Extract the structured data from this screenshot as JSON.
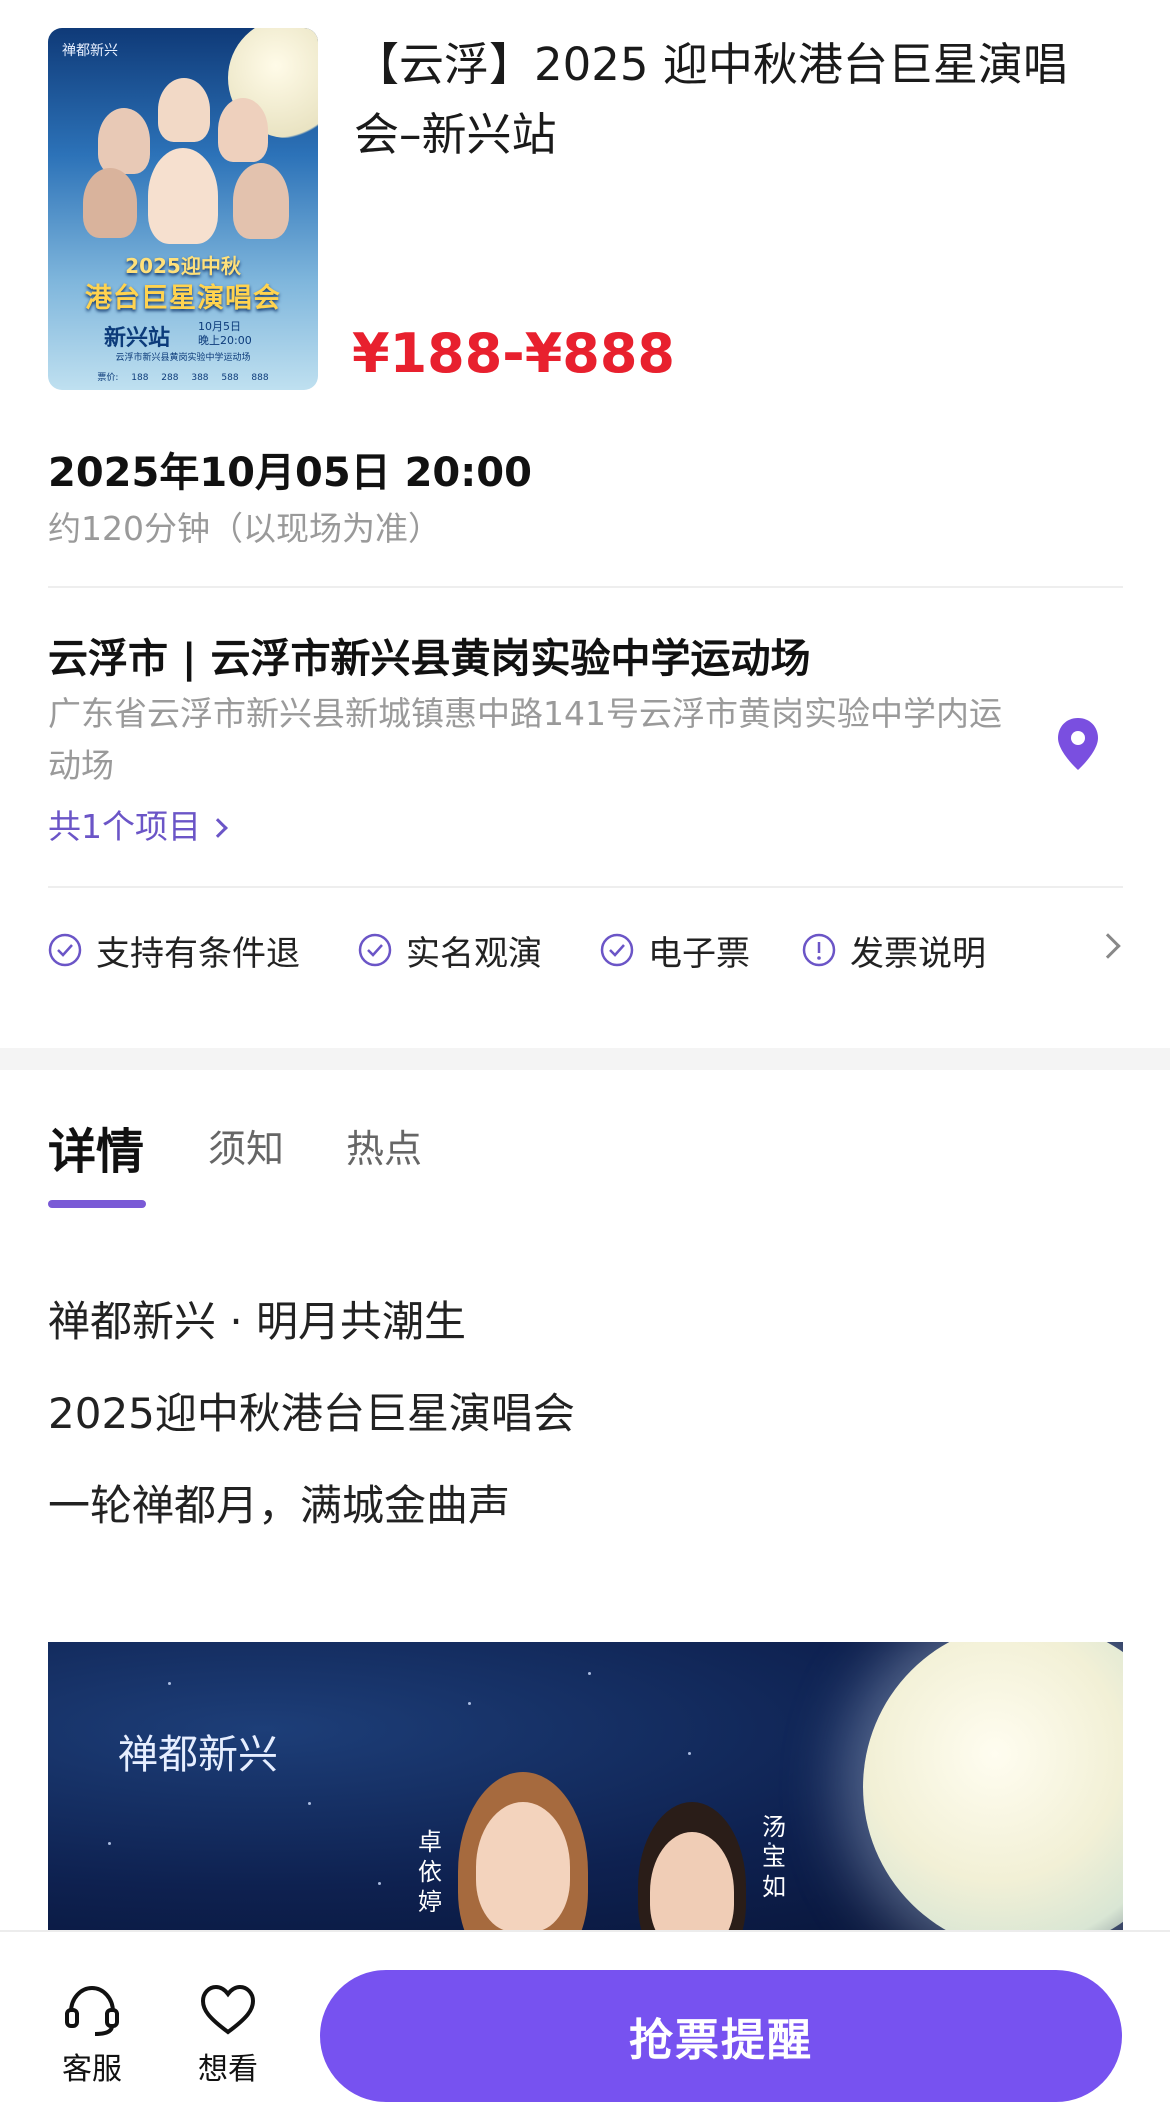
{
  "event": {
    "title": "【云浮】2025 迎中秋港台巨星演唱会–新兴站",
    "price_range": "¥188-¥888",
    "datetime": "2025年10月05日 20:00",
    "duration": "约120分钟（以现场为准）"
  },
  "poster": {
    "brand": "禅都新兴",
    "title_line1": "2025迎中秋",
    "title_line2": "港台巨星演唱会",
    "station": "新兴站",
    "date_text": "10月5日",
    "time_text": "晚上20:00",
    "venue_text": "云浮市新兴县黄岗实验中学运动场",
    "price_text": "票价: 188 288 388 588 888"
  },
  "venue": {
    "name": "云浮市 | 云浮市新兴县黄岗实验中学运动场",
    "address": "广东省云浮市新兴县新城镇惠中路141号云浮市黄岗实验中学内运动场",
    "project_count": "共1个项目"
  },
  "features": [
    {
      "label": "支持有条件退",
      "icon": "check-circle-icon"
    },
    {
      "label": "实名观演",
      "icon": "check-circle-icon"
    },
    {
      "label": "电子票",
      "icon": "check-circle-icon"
    },
    {
      "label": "发票说明",
      "icon": "exclamation-circle-icon"
    }
  ],
  "tabs": [
    {
      "label": "详情",
      "active": true
    },
    {
      "label": "须知",
      "active": false
    },
    {
      "label": "热点",
      "active": false
    }
  ],
  "description": [
    "禅都新兴 · 明月共潮生",
    "2025迎中秋港台巨星演唱会",
    "一轮禅都月，满城金曲声"
  ],
  "banner": {
    "brand": "禅都新兴",
    "artist1": "卓依婷",
    "artist2": "汤宝如"
  },
  "bottom_bar": {
    "service_label": "客服",
    "wish_label": "想看",
    "cta_label": "抢票提醒"
  },
  "colors": {
    "accent": "#7752f0",
    "price": "#e8202e",
    "link": "#6b55c7"
  }
}
